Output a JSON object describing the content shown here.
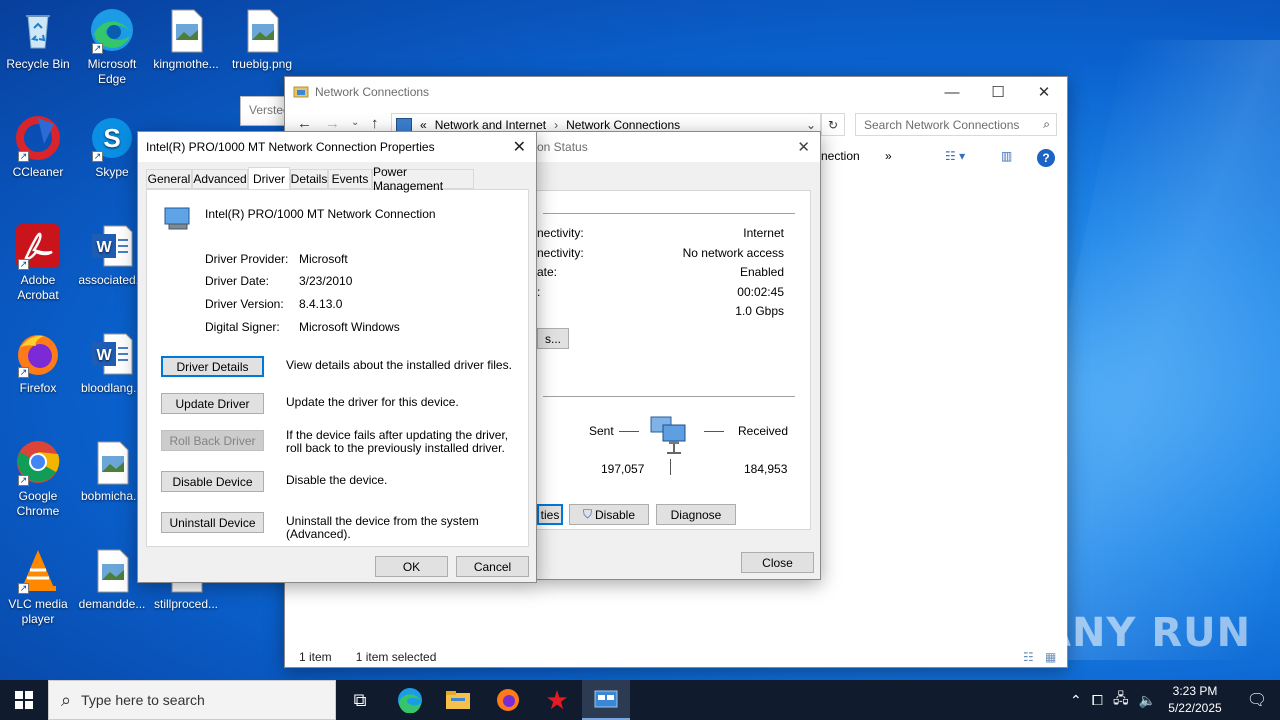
{
  "desktop": {
    "icons": [
      {
        "label": "Recycle Bin",
        "icon": "recycle-bin-icon"
      },
      {
        "label": "Microsoft Edge",
        "icon": "edge-icon"
      },
      {
        "label": "kingmothe...",
        "icon": "image-file-icon"
      },
      {
        "label": "truebig.png",
        "icon": "image-file-icon"
      },
      {
        "label": "CCleaner",
        "icon": "ccleaner-icon"
      },
      {
        "label": "Skype",
        "icon": "skype-icon"
      },
      {
        "label": "Adobe Acrobat",
        "icon": "acrobat-icon"
      },
      {
        "label": "associated...",
        "icon": "word-doc-icon"
      },
      {
        "label": "Firefox",
        "icon": "firefox-icon"
      },
      {
        "label": "bloodlang...",
        "icon": "word-doc-icon"
      },
      {
        "label": "Google Chrome",
        "icon": "chrome-icon"
      },
      {
        "label": "bobmicha...",
        "icon": "image-file-icon"
      },
      {
        "label": "VLC media player",
        "icon": "vlc-icon"
      },
      {
        "label": "demandde...",
        "icon": "image-file-icon"
      },
      {
        "label": "stillproced...",
        "icon": "image-file-icon"
      }
    ],
    "partial_window_text": "Versted"
  },
  "network_connections": {
    "title": "Network Connections",
    "breadcrumb": [
      "«",
      "Network and Internet",
      "Network Connections"
    ],
    "search_placeholder": "Search Network Connections",
    "toolbar_partial": "nection",
    "status_items": "1 item",
    "status_selected": "1 item selected"
  },
  "status_dialog": {
    "title_partial": "on Status",
    "rows": [
      {
        "label": "nectivity:",
        "value": "Internet"
      },
      {
        "label": "nectivity:",
        "value": "No network access"
      },
      {
        "label": "ate:",
        "value": "Enabled"
      },
      {
        "label": ":",
        "value": "00:02:45"
      },
      {
        "label": "",
        "value": "1.0 Gbps"
      }
    ],
    "details_btn_partial": "s...",
    "activity": {
      "sent_label": "Sent",
      "received_label": "Received",
      "sent": "197,057",
      "received": "184,953"
    },
    "properties_btn_partial": "ties",
    "disable_btn": "Disable",
    "diagnose_btn": "Diagnose",
    "close_btn": "Close"
  },
  "properties_dialog": {
    "title": "Intel(R) PRO/1000 MT Network Connection Properties",
    "tabs": [
      "General",
      "Advanced",
      "Driver",
      "Details",
      "Events",
      "Power Management"
    ],
    "active_tab": "Driver",
    "device_name": "Intel(R) PRO/1000 MT Network Connection",
    "info": [
      {
        "label": "Driver Provider:",
        "value": "Microsoft"
      },
      {
        "label": "Driver Date:",
        "value": "3/23/2010"
      },
      {
        "label": "Driver Version:",
        "value": "8.4.13.0"
      },
      {
        "label": "Digital Signer:",
        "value": "Microsoft Windows"
      }
    ],
    "actions": [
      {
        "button": "Driver Details",
        "desc": "View details about the installed driver files."
      },
      {
        "button": "Update Driver",
        "desc": "Update the driver for this device."
      },
      {
        "button": "Roll Back Driver",
        "desc": "If the device fails after updating the driver, roll back to the previously installed driver."
      },
      {
        "button": "Disable Device",
        "desc": "Disable the device."
      },
      {
        "button": "Uninstall Device",
        "desc": "Uninstall the device from the system (Advanced)."
      }
    ],
    "ok": "OK",
    "cancel": "Cancel"
  },
  "taskbar": {
    "search_placeholder": "Type here to search",
    "time": "3:23 PM",
    "date": "5/22/2025"
  },
  "watermark": "ANY RUN"
}
